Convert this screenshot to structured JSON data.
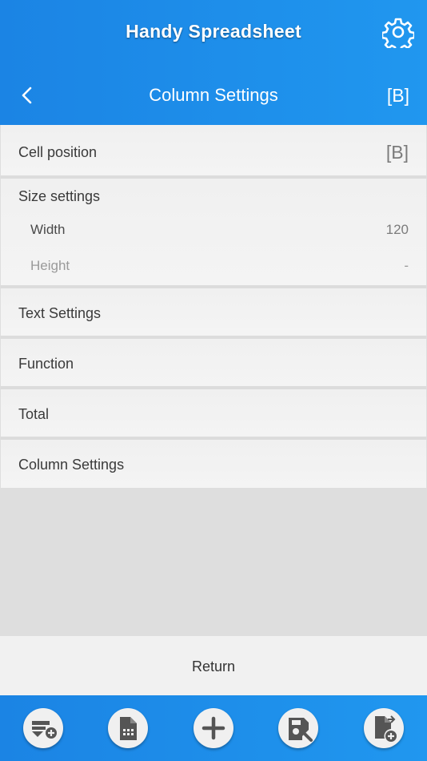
{
  "header": {
    "app_title": "Handy Spreadsheet",
    "page_title": "Column Settings",
    "column_badge": "[B]"
  },
  "list": {
    "cell_position": {
      "label": "Cell position",
      "value": "[B]"
    },
    "size_settings": {
      "label": "Size settings",
      "width": {
        "label": "Width",
        "value": "120"
      },
      "height": {
        "label": "Height",
        "value": "-"
      }
    },
    "text_settings": "Text Settings",
    "function": "Function",
    "total": "Total",
    "column_settings": "Column Settings"
  },
  "footer": {
    "return_label": "Return"
  },
  "toolbar": {
    "icons": [
      "add-row-icon",
      "spreadsheet-file-icon",
      "plus-icon",
      "save-as-icon",
      "new-file-icon"
    ]
  },
  "colors": {
    "accent": "#1e8feb",
    "icon": "#555555"
  }
}
